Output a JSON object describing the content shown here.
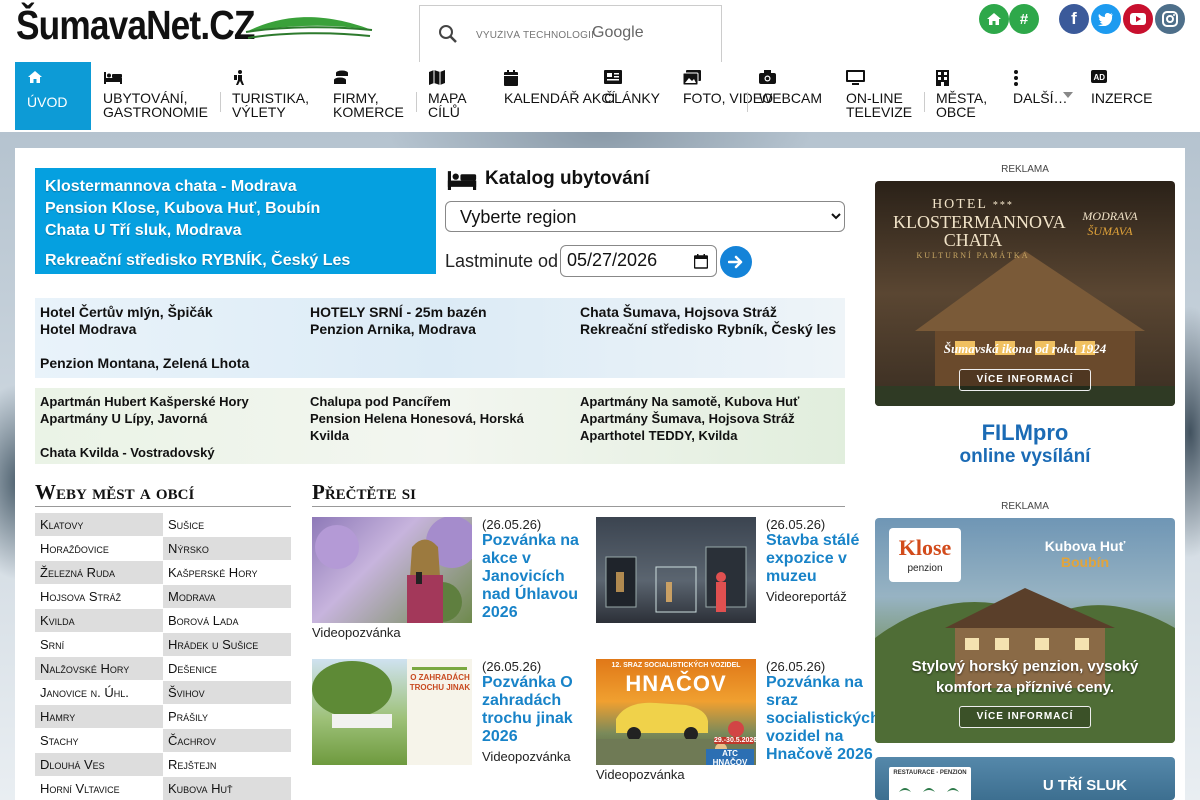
{
  "header": {
    "logo": "ŠumavaNet.CZ",
    "search_placeholder": "VYUŽÍVÁ TECHNOLOGII",
    "search_brand": "Google",
    "home_icon": "home-icon",
    "hash_label": "#",
    "social": [
      "facebook-icon",
      "twitter-icon",
      "youtube-icon",
      "instagram-icon"
    ]
  },
  "nav": {
    "items": [
      {
        "label": "ÚVOD",
        "icon": "home-icon"
      },
      {
        "label": "UBYTOVÁNÍ, GASTRONOMIE",
        "icon": "bed-icon"
      },
      {
        "label": "TURISTIKA, VÝLETY",
        "icon": "hiker-icon"
      },
      {
        "label": "FIRMY, KOMERCE",
        "icon": "coins-icon"
      },
      {
        "label": "MAPA CÍLŮ",
        "icon": "map-icon"
      },
      {
        "label": "KALENDÁŘ AKCÍ",
        "icon": "calendar-icon"
      },
      {
        "label": "ČLÁNKY",
        "icon": "newspaper-icon"
      },
      {
        "label": "FOTO, VIDEO",
        "icon": "images-icon"
      },
      {
        "label": "WEBCAM",
        "icon": "camera-icon"
      },
      {
        "label": "ON-LINE TELEVIZE",
        "icon": "tv-icon"
      },
      {
        "label": "MĚSTA, OBCE",
        "icon": "building-icon"
      },
      {
        "label": "DALŠÍ…",
        "icon": "dots-icon"
      },
      {
        "label": "INZERCE",
        "icon": "ad-icon"
      }
    ]
  },
  "promo": {
    "lines": [
      "Klostermannova chata - Modrava",
      "Pension Klose, Kubova Huť, Boubín",
      "Chata U Tří sluk, Modrava",
      "Rekreační středisko RYBNÍK, Český Les"
    ]
  },
  "katalog": {
    "title": "Katalog ubytování",
    "region_select": "Vyberte region",
    "lastminute_label": "Lastminute od",
    "date_value": "05/27/2026"
  },
  "hotels_blue": {
    "col1": [
      "Hotel Čertův mlýn, Špičák",
      "Hotel Modrava",
      "Penzion Montana, Zelená Lhota"
    ],
    "col2": [
      "HOTELY SRNÍ - 25m bazén",
      "Penzion Arnika, Modrava"
    ],
    "col3": [
      "Chata Šumava, Hojsova Stráž",
      "Rekreační středisko Rybník, Český les"
    ]
  },
  "hotels_green": {
    "col1": [
      "Apartmán Hubert Kašperské Hory",
      "Apartmány U Lípy, Javorná",
      "Chata Kvilda - Vostradovský"
    ],
    "col2": [
      "Chalupa pod Pancířem",
      "Pension Helena Honesová, Horská Kvilda"
    ],
    "col3": [
      "Apartmány Na samotě, Kubova Huť",
      "Apartmány Šumava, Hojsova Stráž",
      "Aparthotel TEDDY, Kvilda"
    ]
  },
  "cities": {
    "title": "Weby měst a obcí",
    "left": [
      "Klatovy",
      "Horažďovice",
      "Železná Ruda",
      "Hojsova Stráž",
      "Kvilda",
      "Srní",
      "Nalžovské Hory",
      "Janovice n. Úhl.",
      "Hamry",
      "Stachy",
      "Dlouhá Ves",
      "Horní Vltavice"
    ],
    "right": [
      "Sušice",
      "Nýrsko",
      "Kašperské Hory",
      "Modrava",
      "Borová Lada",
      "Hrádek u Sušice",
      "Dešenice",
      "Švihov",
      "Prášily",
      "Čachrov",
      "Rejštejn",
      "Kubova Huť"
    ]
  },
  "articles": {
    "title": "Přečtěte si",
    "items": [
      {
        "date": "(26.05.26)",
        "title": "Pozvánka na akce v Janovicích nad Úhlavou 2026",
        "type": "Videopozvánka"
      },
      {
        "date": "(26.05.26)",
        "title": "Stavba stálé expozice v muzeu",
        "type": "Videoreportáž"
      },
      {
        "date": "(26.05.26)",
        "title": "Pozvánka O zahradách trochu jinak 2026",
        "type": "Videopozvánka"
      },
      {
        "date": "(26.05.26)",
        "title": "Pozvánka na sraz socialistických vozidel na Hnačově 2026",
        "type": "Videopozvánka"
      }
    ],
    "img3_text": [
      "O ZAHRADÁCH",
      "TROCHU JINAK"
    ],
    "img4_text": [
      "12. SRAZ SOCIALISTICKÝCH VOZIDEL",
      "HNAČOV",
      "29.-30.5.2026",
      "ATC HNAČOV"
    ]
  },
  "ads": {
    "reklama": "REKLAMA",
    "ad1": {
      "hotel": "HOTEL",
      "stars": "***",
      "name1": "KLOSTERMANNOVA",
      "name2": "CHATA",
      "sub": "KULTURNÍ PAMÁTKA",
      "place1": "MODRAVA",
      "place2": "ŠUMAVA",
      "slogan": "Šumavská ikona od roku 1924",
      "btn": "VÍCE INFORMACÍ"
    },
    "film": {
      "line1": "FILMpro",
      "line2": "online vysílání"
    },
    "ad2": {
      "logo1": "Klose",
      "logo2": "penzion",
      "place1": "Kubova Huť",
      "place2": "Boubín",
      "slogan": "Stylový horský penzion, vysoký komfort za příznivé ceny.",
      "btn": "VÍCE INFORMACÍ"
    },
    "ad3": {
      "logo": "RESTAURACE - PENZION",
      "title": "U TŘÍ SLUK"
    }
  }
}
